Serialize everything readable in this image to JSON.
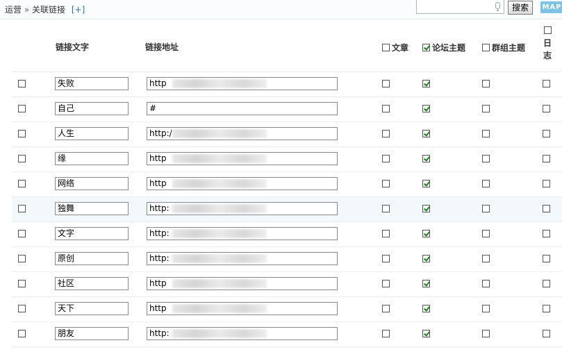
{
  "breadcrumb": {
    "section": "运营",
    "separator": "»",
    "page": "关联链接",
    "add_label": "[+]"
  },
  "search": {
    "value": "",
    "button_label": "搜索",
    "map_label": "MAP"
  },
  "columns": {
    "text": "链接文字",
    "url": "链接地址",
    "article": "文章",
    "forum_thread": "论坛主题",
    "group_thread": "群组主题",
    "log_char1": "日",
    "log_char2": "志"
  },
  "header_checks": {
    "article": false,
    "forum_thread": true,
    "group_thread": false,
    "log": false
  },
  "rows": [
    {
      "text": "失败",
      "url": "http",
      "article": false,
      "forum_thread": true,
      "group_thread": false,
      "log": false,
      "blurred": true
    },
    {
      "text": "自己",
      "url": "#",
      "article": false,
      "forum_thread": true,
      "group_thread": false,
      "log": false,
      "blurred": false
    },
    {
      "text": "人生",
      "url": "http:/",
      "article": false,
      "forum_thread": true,
      "group_thread": false,
      "log": false,
      "blurred": true
    },
    {
      "text": "缘",
      "url": "http",
      "article": false,
      "forum_thread": true,
      "group_thread": false,
      "log": false,
      "blurred": true
    },
    {
      "text": "网络",
      "url": "http",
      "article": false,
      "forum_thread": true,
      "group_thread": false,
      "log": false,
      "blurred": true
    },
    {
      "text": "独舞",
      "url": "http:",
      "article": false,
      "forum_thread": true,
      "group_thread": false,
      "log": false,
      "blurred": true
    },
    {
      "text": "文字",
      "url": "http:",
      "article": false,
      "forum_thread": true,
      "group_thread": false,
      "log": false,
      "blurred": true
    },
    {
      "text": "原创",
      "url": "http:",
      "article": false,
      "forum_thread": true,
      "group_thread": false,
      "log": false,
      "blurred": true
    },
    {
      "text": "社区",
      "url": "http",
      "article": false,
      "forum_thread": true,
      "group_thread": false,
      "log": false,
      "blurred": true
    },
    {
      "text": "天下",
      "url": "http",
      "article": false,
      "forum_thread": true,
      "group_thread": false,
      "log": false,
      "blurred": true
    },
    {
      "text": "朋友",
      "url": "http:",
      "article": false,
      "forum_thread": true,
      "group_thread": false,
      "log": false,
      "blurred": true
    }
  ]
}
